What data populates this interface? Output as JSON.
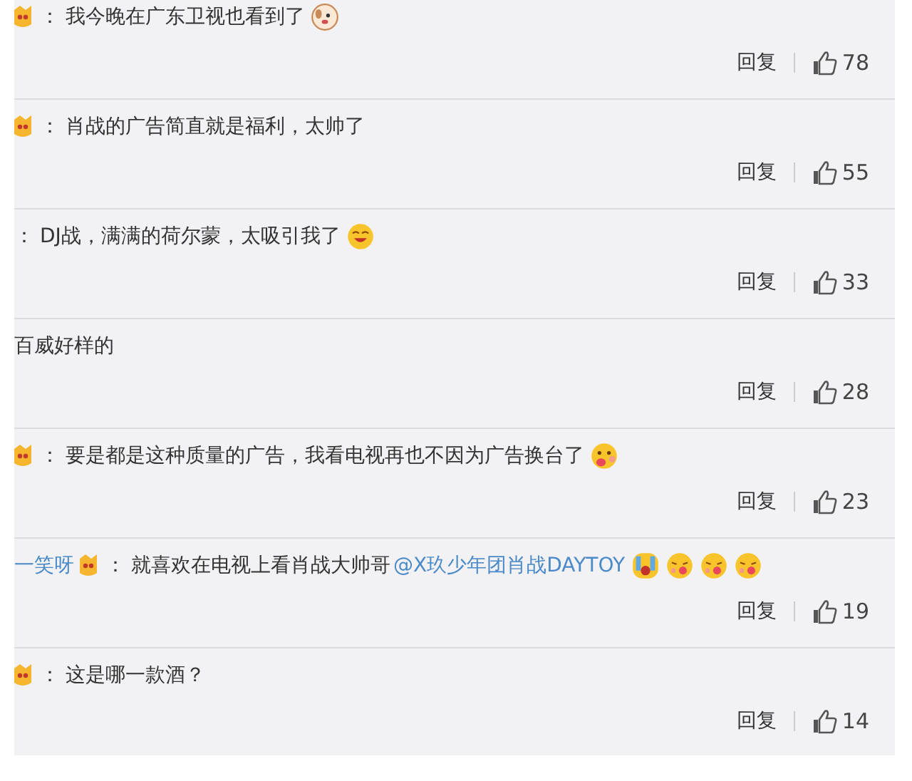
{
  "comments": [
    {
      "badge": true,
      "separator": "：",
      "text": "我今晚在广东卫视也看到了",
      "emojis": [
        {
          "kind": "dog"
        }
      ],
      "reply": "回复",
      "likes": "78"
    },
    {
      "badge": true,
      "separator": "：",
      "text": "肖战的广告简直就是福利，太帅了",
      "reply": "回复",
      "likes": "55"
    },
    {
      "badge": false,
      "separator": "：",
      "text": "DJ战，满满的荷尔蒙，太吸引我了",
      "emojis": [
        {
          "kind": "grin"
        }
      ],
      "reply": "回复",
      "likes": "33"
    },
    {
      "badge": false,
      "text": "百威好样的",
      "reply": "回复",
      "likes": "28"
    },
    {
      "badge": true,
      "separator": "：",
      "text": "要是都是这种质量的广告，我看电视再也不因为广告换台了",
      "emojis": [
        {
          "kind": "tongue"
        }
      ],
      "reply": "回复",
      "likes": "23"
    },
    {
      "user": "一笑呀",
      "badge": true,
      "separator": "：",
      "text": "就喜欢在电视上看肖战大帅哥",
      "mention": "@X玖少年团肖战DAYTOY",
      "emojis": [
        {
          "kind": "cry"
        },
        {
          "kind": "kiss"
        },
        {
          "kind": "kiss"
        },
        {
          "kind": "kiss"
        }
      ],
      "reply": "回复",
      "likes": "19"
    },
    {
      "badge": true,
      "separator": "：",
      "text": "这是哪一款酒？",
      "reply": "回复",
      "likes": "14"
    }
  ]
}
